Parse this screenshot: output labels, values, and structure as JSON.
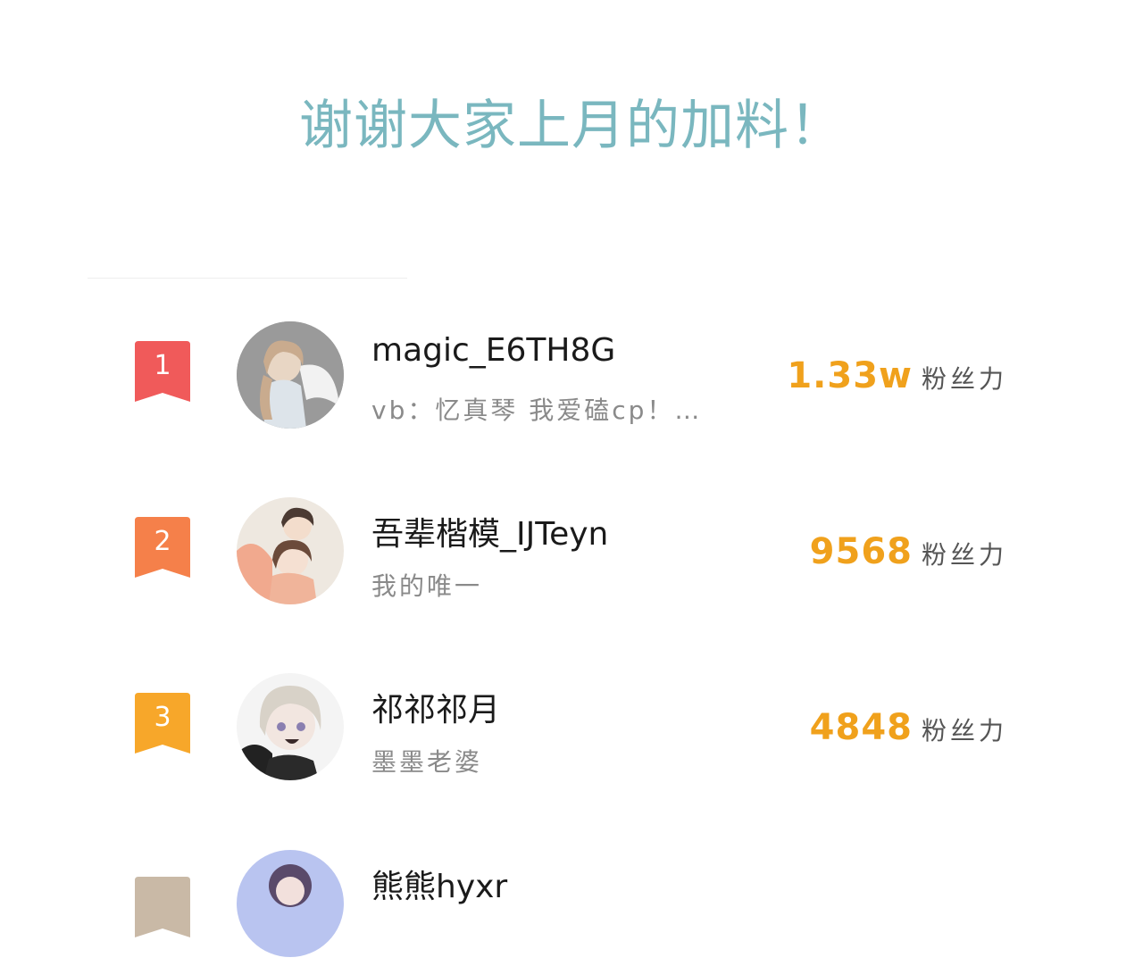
{
  "page": {
    "title": "谢谢大家上月的加料！"
  },
  "rankings": [
    {
      "rank": "1",
      "rank_color": "#f05a5a",
      "avatar_icon": "anime-angel-avatar",
      "name": "magic_E6TH8G",
      "bio": "vb：忆真琴  我爱磕cp！…",
      "score": "1.33w",
      "unit": "粉丝力"
    },
    {
      "rank": "2",
      "rank_color": "#f5804a",
      "avatar_icon": "anime-couple-avatar",
      "name": "吾辈楷模_IJTeyn",
      "bio": "我的唯一",
      "score": "9568",
      "unit": "粉丝力"
    },
    {
      "rank": "3",
      "rank_color": "#f7a72a",
      "avatar_icon": "anime-girl-avatar",
      "name": "祁祁祁月",
      "bio": "墨墨老婆",
      "score": "4848",
      "unit": "粉丝力"
    },
    {
      "rank": "",
      "rank_color": "#c9b9a6",
      "avatar_icon": "anime-portrait-avatar",
      "name": "熊熊hyxr",
      "bio": "",
      "score": "",
      "unit": ""
    }
  ]
}
